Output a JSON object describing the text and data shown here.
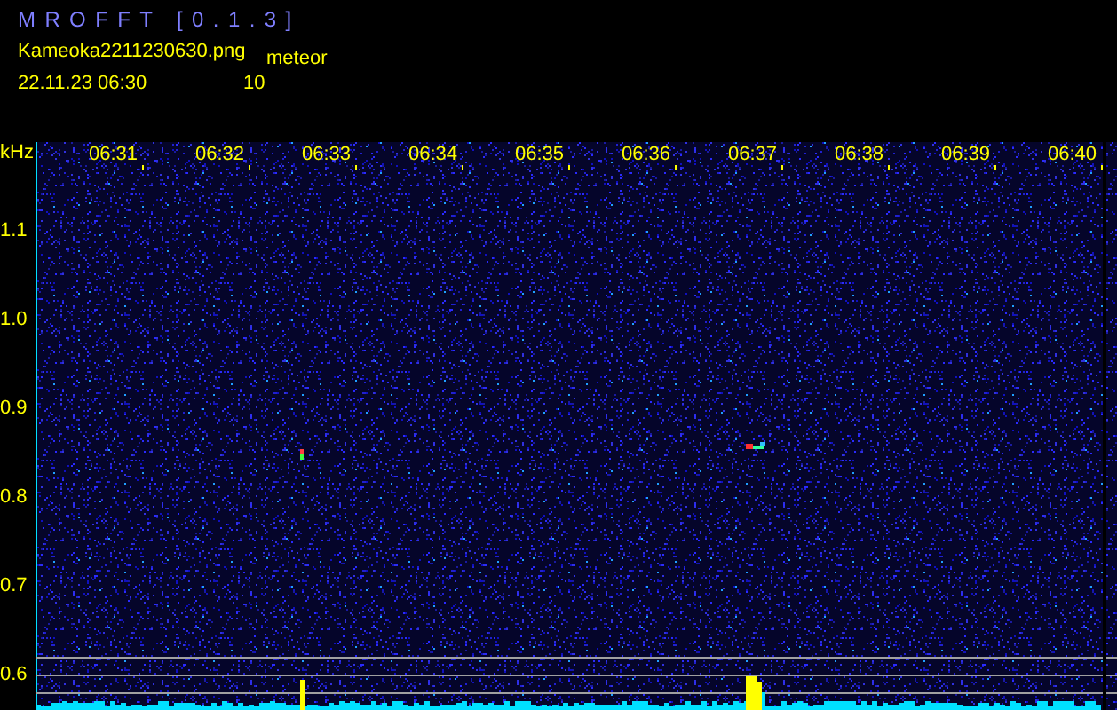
{
  "header": {
    "title": "MROFFT [0.1.3]",
    "filename": "Kameoka2211230630.png",
    "count_label": "meteor",
    "datetime": "22.11.23 06:30",
    "count": "10"
  },
  "spectrogram": {
    "unit": "kHz",
    "y_labels": [
      "1.1",
      "1.0",
      "0.9",
      "0.8",
      "0.7",
      "0.6"
    ],
    "x_labels": [
      "06:31",
      "06:32",
      "06:33",
      "06:34",
      "06:35",
      "06:36",
      "06:37",
      "06:38",
      "06:39",
      "06:40"
    ]
  }
}
